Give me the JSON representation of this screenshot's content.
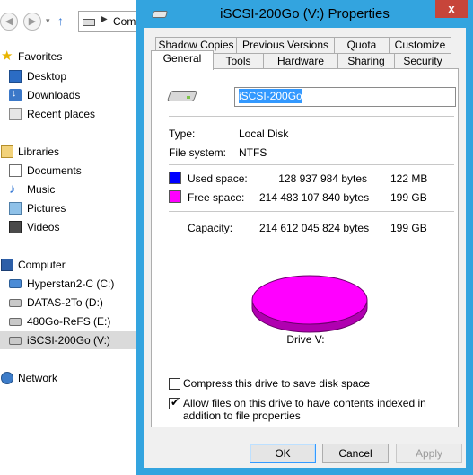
{
  "explorer": {
    "address_text": "Com",
    "favorites": [
      {
        "label": "Favorites",
        "icon": "star-icon"
      },
      {
        "label": "Desktop",
        "icon": "desktop-icon"
      },
      {
        "label": "Downloads",
        "icon": "downloads-icon"
      },
      {
        "label": "Recent places",
        "icon": "recent-places-icon"
      }
    ],
    "libraries": [
      {
        "label": "Libraries",
        "icon": "libraries-icon"
      },
      {
        "label": "Documents",
        "icon": "documents-icon"
      },
      {
        "label": "Music",
        "icon": "music-icon"
      },
      {
        "label": "Pictures",
        "icon": "pictures-icon"
      },
      {
        "label": "Videos",
        "icon": "videos-icon"
      }
    ],
    "computer": [
      {
        "label": "Computer",
        "icon": "computer-icon"
      },
      {
        "label": "Hyperstan2-C (C:)",
        "icon": "system-drive-icon"
      },
      {
        "label": "DATAS-2To (D:)",
        "icon": "drive-icon"
      },
      {
        "label": "480Go-ReFS (E:)",
        "icon": "drive-icon"
      },
      {
        "label": "iSCSI-200Go (V:)",
        "icon": "drive-icon",
        "selected": true
      }
    ],
    "network": {
      "label": "Network",
      "icon": "network-icon"
    }
  },
  "dialog": {
    "title": "iSCSI-200Go (V:) Properties",
    "close_glyph": "x",
    "tabs_back": [
      "Shadow Copies",
      "Previous Versions",
      "Quota",
      "Customize"
    ],
    "tabs_front": [
      "General",
      "Tools",
      "Hardware",
      "Sharing",
      "Security"
    ],
    "active_tab": "General",
    "drive_name": "iSCSI-200Go",
    "type_label": "Type:",
    "type_value": "Local Disk",
    "fs_label": "File system:",
    "fs_value": "NTFS",
    "used": {
      "label": "Used space:",
      "bytes": "128 937 984 bytes",
      "short": "122 MB",
      "color": "#0000ff"
    },
    "free": {
      "label": "Free space:",
      "bytes": "214 483 107 840 bytes",
      "short": "199 GB",
      "color": "#ff00ff"
    },
    "capacity": {
      "label": "Capacity:",
      "bytes": "214 612 045 824 bytes",
      "short": "199 GB"
    },
    "drive_label": "Drive V:",
    "compress": {
      "label": "Compress this drive to save disk space",
      "checked": false
    },
    "index": {
      "label": "Allow files on this drive to have contents indexed in addition to file properties",
      "checked": true
    },
    "buttons": {
      "ok": "OK",
      "cancel": "Cancel",
      "apply": "Apply"
    },
    "colors": {
      "accent": "#33a4df",
      "close": "#c7453a"
    }
  }
}
